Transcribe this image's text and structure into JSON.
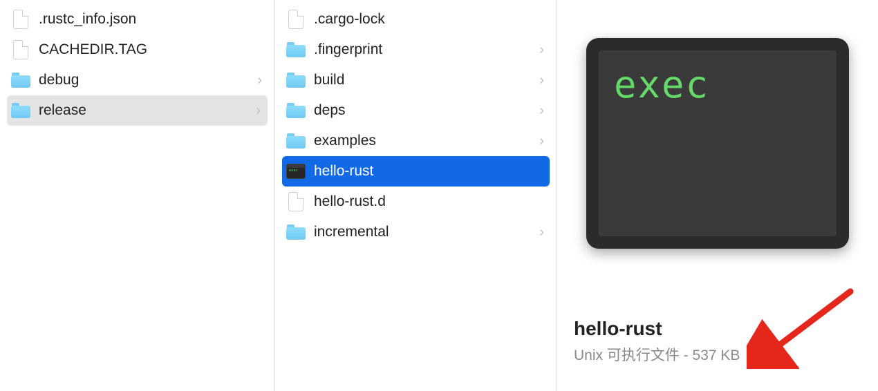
{
  "column1": {
    "items": [
      {
        "kind": "file",
        "label": ".rustc_info.json",
        "hasChildren": false
      },
      {
        "kind": "file",
        "label": "CACHEDIR.TAG",
        "hasChildren": false
      },
      {
        "kind": "folder",
        "label": "debug",
        "hasChildren": true
      },
      {
        "kind": "folder",
        "label": "release",
        "hasChildren": true,
        "selected": "grey"
      }
    ]
  },
  "column2": {
    "items": [
      {
        "kind": "file",
        "label": ".cargo-lock",
        "hasChildren": false
      },
      {
        "kind": "folder",
        "label": ".fingerprint",
        "hasChildren": true
      },
      {
        "kind": "folder",
        "label": "build",
        "hasChildren": true
      },
      {
        "kind": "folder",
        "label": "deps",
        "hasChildren": true
      },
      {
        "kind": "folder",
        "label": "examples",
        "hasChildren": true
      },
      {
        "kind": "exec",
        "label": "hello-rust",
        "hasChildren": false,
        "selected": "blue"
      },
      {
        "kind": "file",
        "label": "hello-rust.d",
        "hasChildren": false
      },
      {
        "kind": "folder",
        "label": "incremental",
        "hasChildren": true
      }
    ]
  },
  "preview": {
    "badge_text": "exec",
    "filename": "hello-rust",
    "kind_label": "Unix 可执行文件",
    "separator": " - ",
    "size_label": "537 KB"
  },
  "chevron_glyph": "›"
}
